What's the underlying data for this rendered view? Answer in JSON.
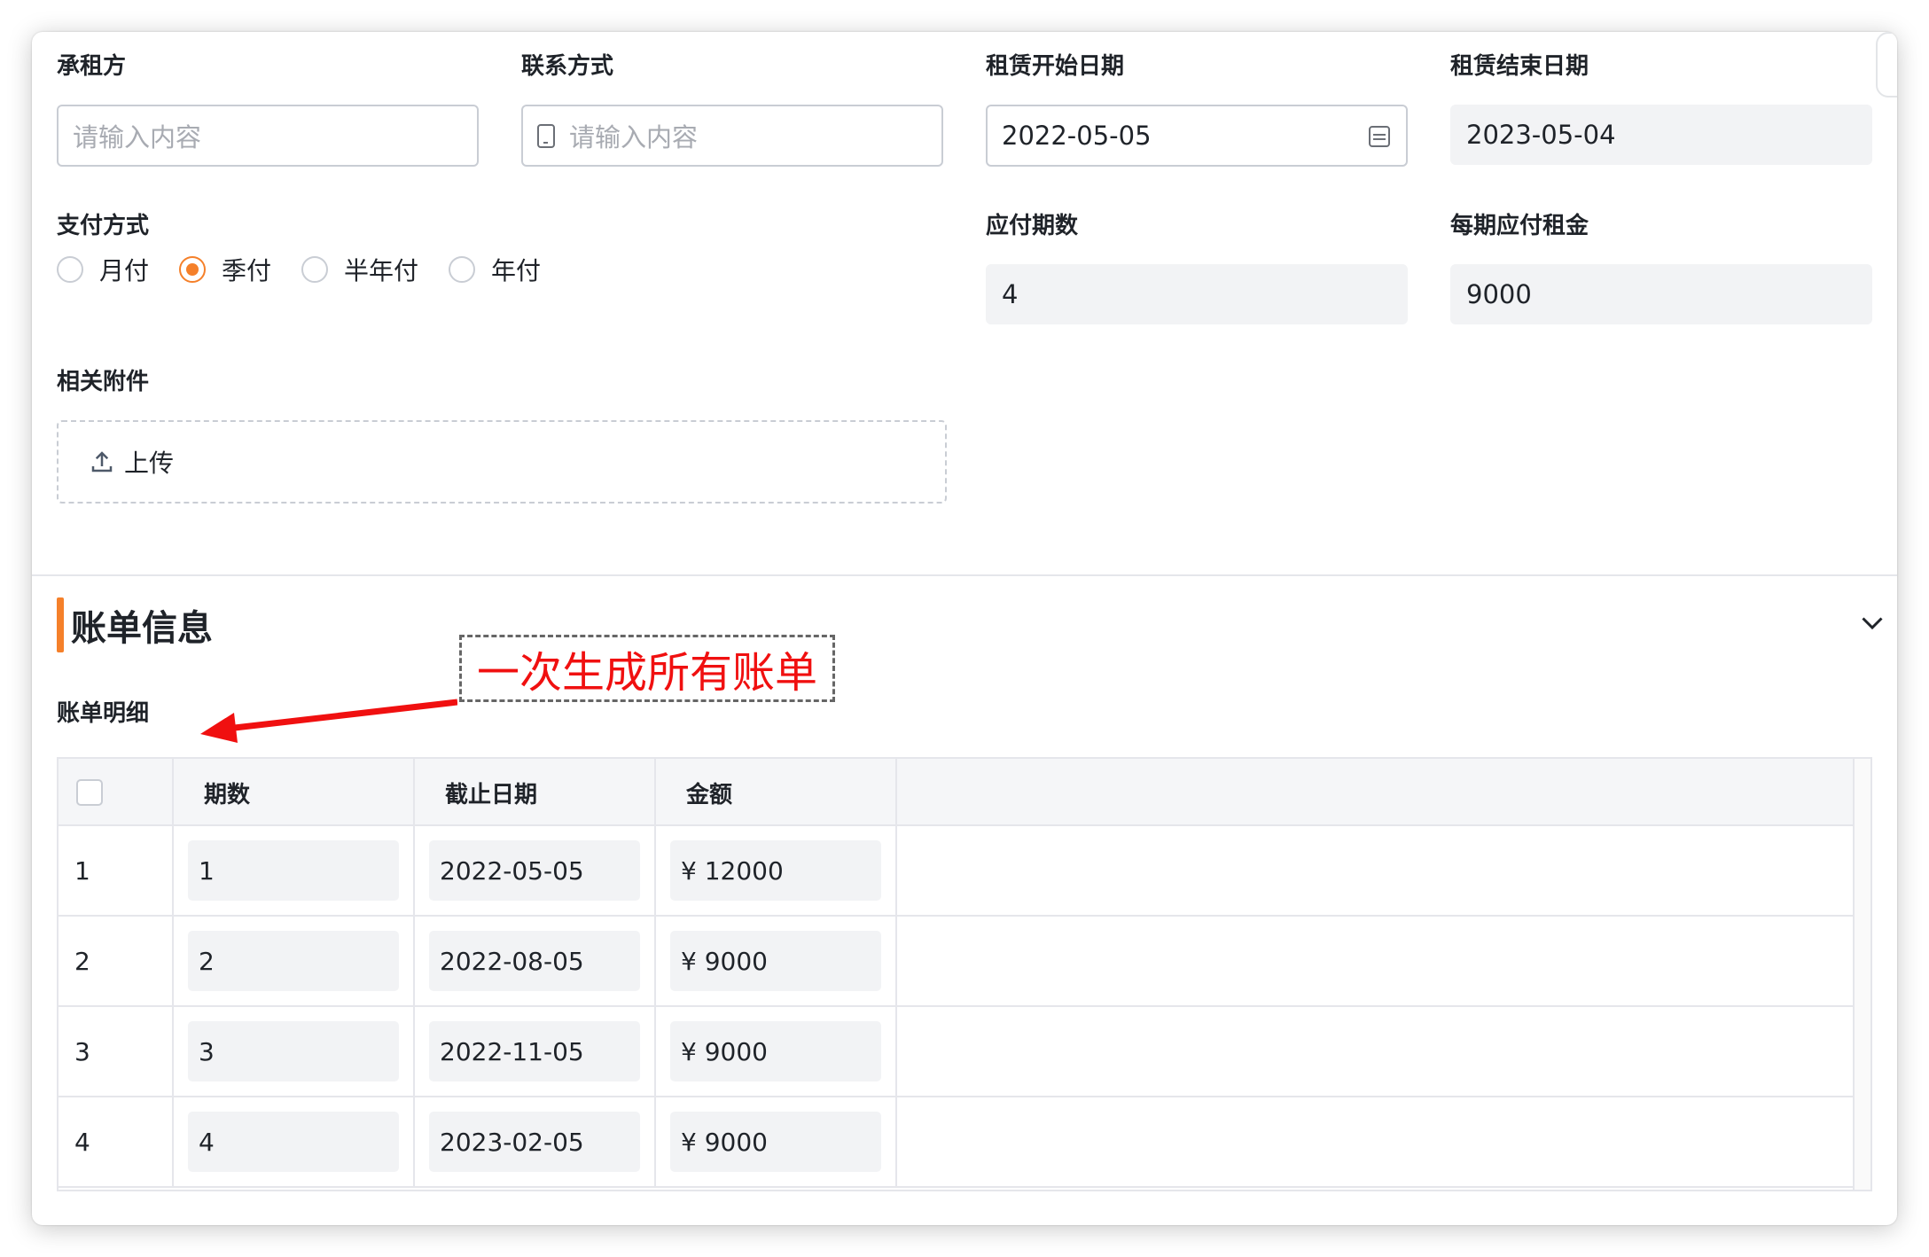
{
  "form": {
    "lessee": {
      "label": "承租方",
      "placeholder": "请输入内容"
    },
    "contact": {
      "label": "联系方式",
      "placeholder": "请输入内容",
      "icon": "phone-icon"
    },
    "start_date": {
      "label": "租赁开始日期",
      "value": "2022-05-05",
      "icon": "calendar-icon"
    },
    "end_date": {
      "label": "租赁结束日期",
      "value": "2023-05-04"
    },
    "payment": {
      "label": "支付方式",
      "options": [
        "月付",
        "季付",
        "半年付",
        "年付"
      ],
      "selected": "季付"
    },
    "periods": {
      "label": "应付期数",
      "value": "4"
    },
    "rent_per_period": {
      "label": "每期应付租金",
      "value": "9000"
    },
    "attachments": {
      "label": "相关附件",
      "upload_label": "上传",
      "icon": "upload-icon"
    }
  },
  "billing": {
    "section_title": "账单信息",
    "detail_title": "账单明细",
    "annotation": "一次生成所有账单",
    "columns": [
      "期数",
      "截止日期",
      "金额"
    ],
    "rows": [
      {
        "index": "1",
        "period": "1",
        "due_date": "2022-05-05",
        "amount": "¥ 12000"
      },
      {
        "index": "2",
        "period": "2",
        "due_date": "2022-08-05",
        "amount": "¥ 9000"
      },
      {
        "index": "3",
        "period": "3",
        "due_date": "2022-11-05",
        "amount": "¥ 9000"
      },
      {
        "index": "4",
        "period": "4",
        "due_date": "2023-02-05",
        "amount": "¥ 9000"
      }
    ]
  },
  "colors": {
    "accent": "#f5802a",
    "annotation": "#f01010"
  }
}
